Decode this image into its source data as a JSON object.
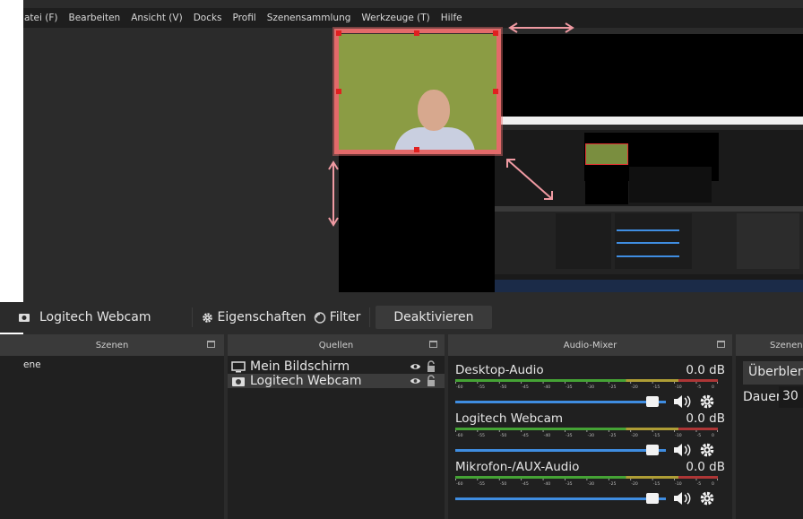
{
  "menu": [
    "atei (F)",
    "Bearbeiten",
    "Ansicht (V)",
    "Docks",
    "Profil",
    "Szenensammlung",
    "Werkzeuge (T)",
    "Hilfe"
  ],
  "toolbar": {
    "source_name": "Logitech Webcam",
    "properties": "Eigenschaften",
    "filter": "Filter",
    "deactivate": "Deaktivieren"
  },
  "scenes": {
    "title": "Szenen",
    "items": [
      "ene"
    ]
  },
  "sources": {
    "title": "Quellen",
    "items": [
      {
        "name": "Mein Bildschirm",
        "icon": "monitor-icon"
      },
      {
        "name": "Logitech Webcam",
        "icon": "camera-icon"
      }
    ]
  },
  "audio_mixer": {
    "title": "Audio-Mixer",
    "tracks": [
      {
        "name": "Desktop-Audio",
        "level": "0.0 dB",
        "volume": 0.95
      },
      {
        "name": "Logitech Webcam",
        "level": "0.0 dB",
        "volume": 0.95
      },
      {
        "name": "Mikrofon-/AUX-Audio",
        "level": "0.0 dB",
        "volume": 0.95
      }
    ],
    "scale": [
      "-60",
      "-55",
      "-50",
      "-45",
      "-40",
      "-35",
      "-30",
      "-25",
      "-20",
      "-15",
      "-10",
      "-5",
      "0"
    ]
  },
  "transitions": {
    "title": "Szenen",
    "button": "Überblenden",
    "duration_label": "Dauer",
    "duration_value": "30"
  },
  "colors": {
    "accent_red": "#e36a6a",
    "fader_blue": "#3f8de1",
    "meter_green": "#4cbb3a",
    "meter_yellow": "#c8b43a",
    "meter_red": "#c73b3b"
  }
}
